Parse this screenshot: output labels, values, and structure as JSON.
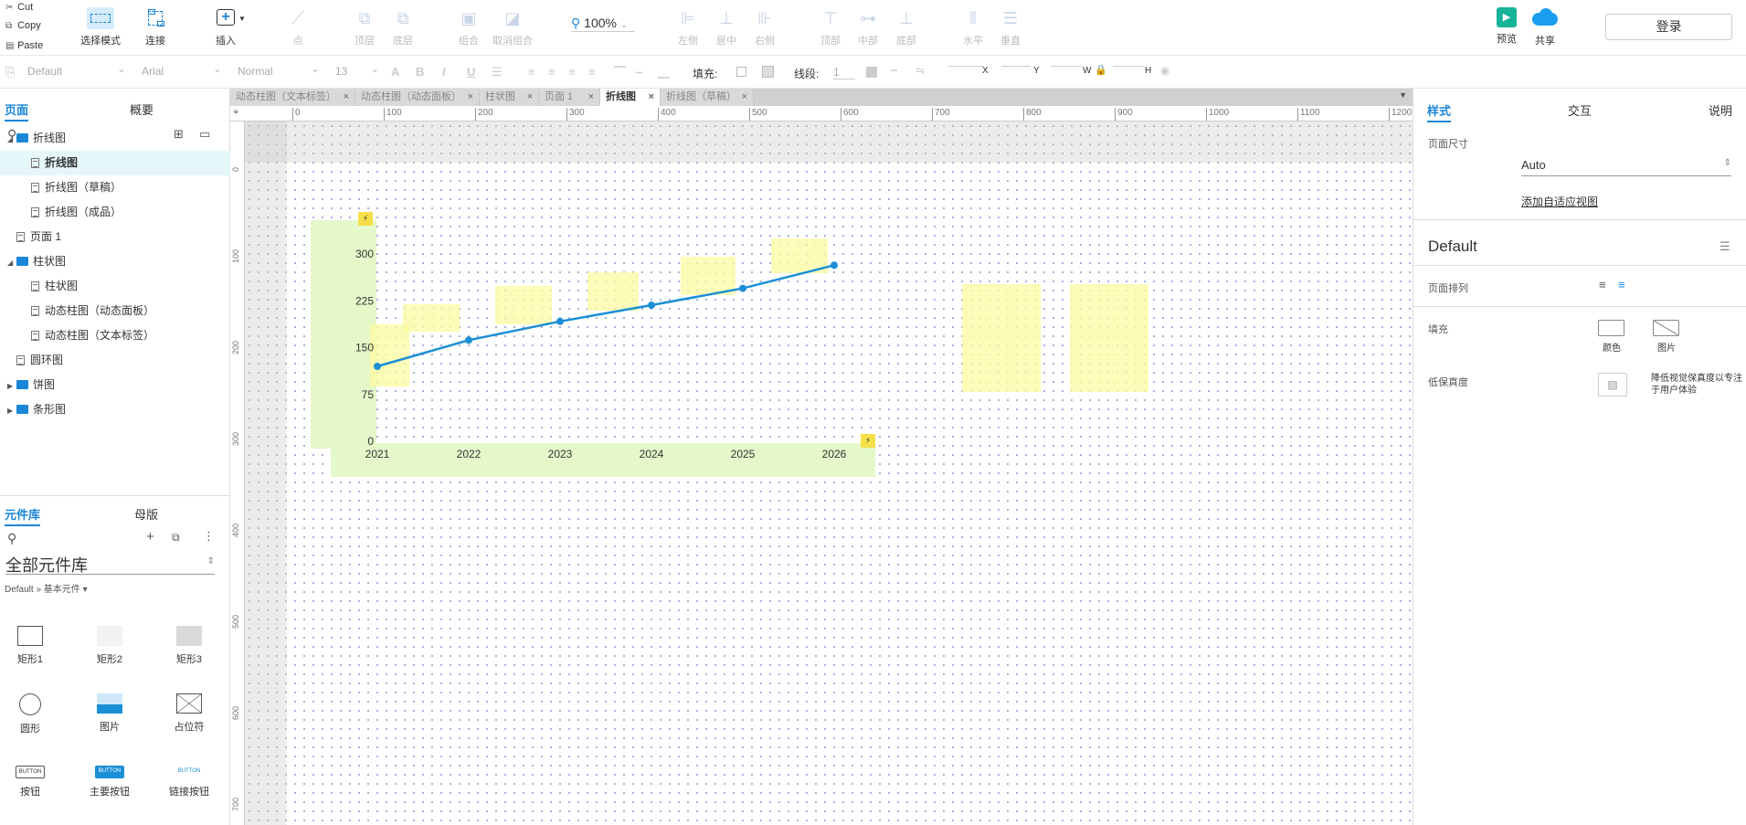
{
  "clipboard": {
    "cut": "Cut",
    "copy": "Copy",
    "paste": "Paste"
  },
  "toolbar": {
    "select_mode": "选择模式",
    "connect": "连接",
    "insert": "插入",
    "point": "点",
    "top": "顶层",
    "bottom": "底层",
    "group": "组合",
    "ungroup": "取消组合",
    "zoom": "100%",
    "align_left": "左侧",
    "align_center": "居中",
    "align_right": "右侧",
    "align_top": "顶部",
    "align_middle": "中部",
    "align_bottom": "底部",
    "dist_h": "水平",
    "dist_v": "垂直",
    "preview": "预览",
    "share": "共享",
    "login": "登录"
  },
  "format": {
    "style": "Default",
    "font": "Arial",
    "weight": "Normal",
    "size": "13",
    "fill_label": "填充:",
    "stroke_label": "线段:",
    "stroke_value": "1",
    "x": "X",
    "y": "Y",
    "w": "W",
    "h": "H"
  },
  "pages_panel": {
    "tab_pages": "页面",
    "tab_outline": "概要",
    "items": [
      {
        "label": "折线图",
        "type": "folder",
        "level": 0,
        "open": true
      },
      {
        "label": "折线图",
        "type": "page",
        "level": 1,
        "selected": true
      },
      {
        "label": "折线图（草稿）",
        "type": "page",
        "level": 1
      },
      {
        "label": "折线图（成品）",
        "type": "page",
        "level": 1
      },
      {
        "label": "页面 1",
        "type": "page",
        "level": 0
      },
      {
        "label": "柱状图",
        "type": "folder",
        "level": 0,
        "open": true
      },
      {
        "label": "柱状图",
        "type": "page",
        "level": 1
      },
      {
        "label": "动态柱图（动态面板）",
        "type": "page",
        "level": 1
      },
      {
        "label": "动态柱图（文本标签）",
        "type": "page",
        "level": 1
      },
      {
        "label": "圆环图",
        "type": "page",
        "level": 0
      },
      {
        "label": "饼图",
        "type": "folder",
        "level": 0,
        "open": false
      },
      {
        "label": "条形图",
        "type": "folder",
        "level": 0,
        "open": false
      }
    ]
  },
  "library": {
    "tab_library": "元件库",
    "tab_masters": "母版",
    "title": "全部元件库",
    "path": "Default » 基本元件 ▾",
    "items": [
      "矩形1",
      "矩形2",
      "矩形3",
      "圆形",
      "图片",
      "占位符",
      "按钮",
      "主要按钮",
      "链接按钮"
    ],
    "btn_text": "BUTTON"
  },
  "tabs": [
    {
      "label": "动态柱图（文本标签）",
      "active": false
    },
    {
      "label": "动态柱图（动态面板）",
      "active": false
    },
    {
      "label": "柱状图",
      "active": false
    },
    {
      "label": "页面 1",
      "active": false
    },
    {
      "label": "折线图",
      "active": true
    },
    {
      "label": "折线图（草稿）",
      "active": false
    }
  ],
  "ruler": {
    "h": [
      "0",
      "100",
      "200",
      "300",
      "400",
      "500",
      "600",
      "700",
      "800",
      "900",
      "1000",
      "1100",
      "1200"
    ],
    "v": [
      "0",
      "100",
      "200",
      "300",
      "400",
      "500",
      "600",
      "700"
    ]
  },
  "chart_data": {
    "type": "line",
    "categories": [
      "2021",
      "2022",
      "2023",
      "2024",
      "2025",
      "2026"
    ],
    "values": [
      120,
      162,
      192,
      218,
      245,
      282
    ],
    "y_ticks": [
      "300",
      "225",
      "150",
      "75",
      "0"
    ],
    "ylim": [
      0,
      300
    ],
    "color": "#1a8fd6"
  },
  "right_panel": {
    "tab_style": "样式",
    "tab_interaction": "交互",
    "tab_notes": "说明",
    "page_size_label": "页面尺寸",
    "page_size_value": "Auto",
    "add_adaptive": "添加自适应视图",
    "style_name": "Default",
    "page_align_label": "页面排列",
    "fill_label": "填充",
    "fill_color": "颜色",
    "fill_image": "图片",
    "low_fidelity_label": "低保真度",
    "low_fidelity_desc": "降低视觉保真度以专注于用户体验"
  },
  "colors": {
    "accent": "#1a86d8",
    "selected_bg": "#e6f7fa",
    "green_panel": "#e5f8c9",
    "yellow_note": "#fbfbb9"
  }
}
